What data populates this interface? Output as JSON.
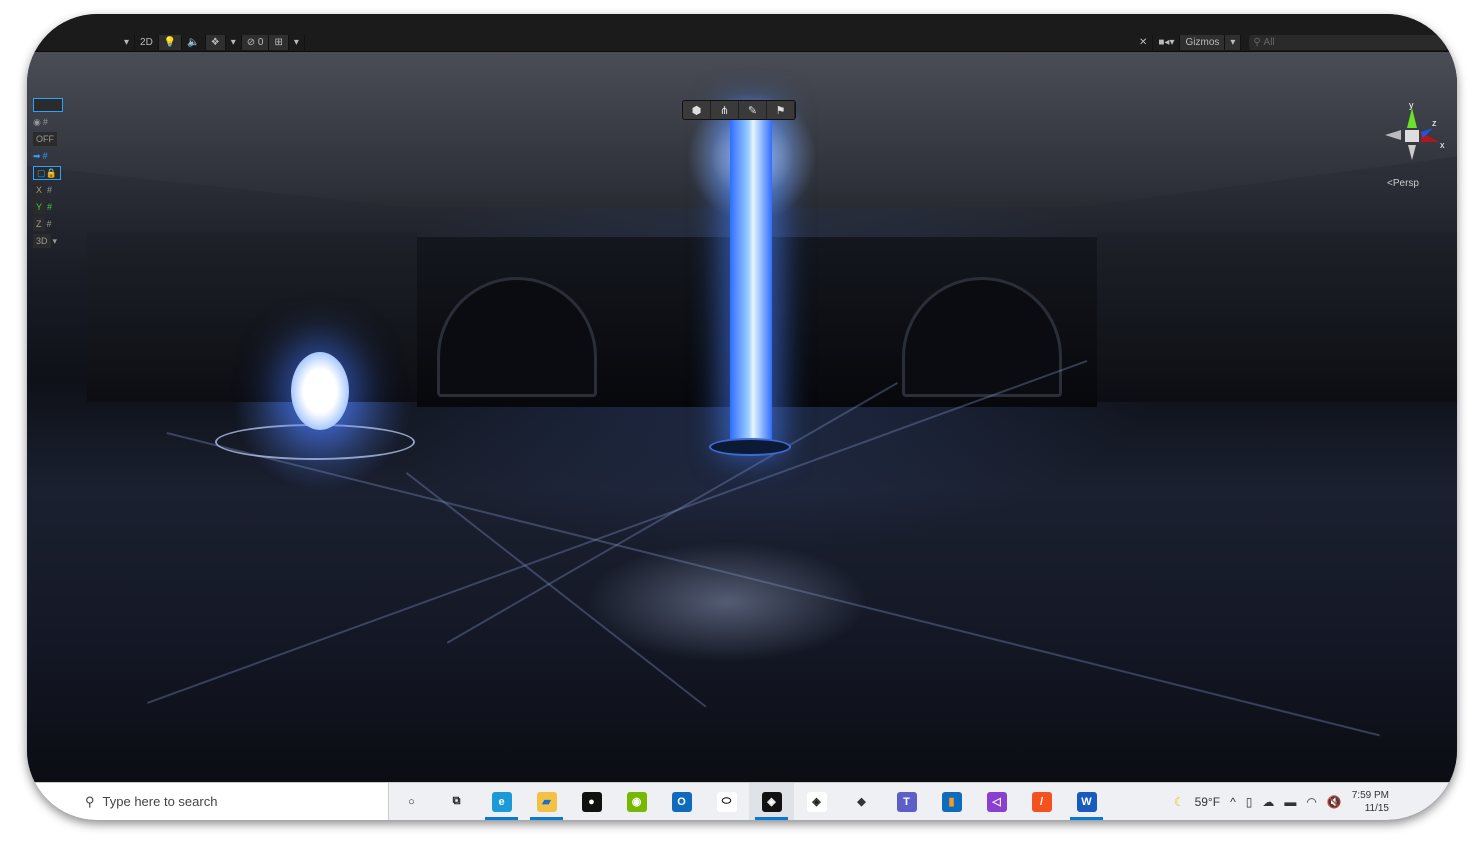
{
  "toolbar": {
    "view_mode": "2D",
    "hidden_count": "0",
    "gizmos_label": "Gizmos",
    "search_placeholder": "All"
  },
  "overlay_tools": [
    "cube-icon",
    "nodes-icon",
    "pen-icon",
    "flag-icon"
  ],
  "left_tools": {
    "off_label": "OFF",
    "x": "X",
    "y": "Y",
    "z": "Z",
    "three_d": "3D"
  },
  "gizmo": {
    "y": "y",
    "z": "z",
    "x": "x",
    "projection": "Persp"
  },
  "taskbar": {
    "search_placeholder": "Type here to search",
    "apps": [
      {
        "name": "cortana",
        "glyph": "○",
        "bg": "transparent",
        "color": "#222"
      },
      {
        "name": "task-view",
        "glyph": "⧉",
        "bg": "transparent",
        "color": "#222"
      },
      {
        "name": "edge",
        "glyph": "e",
        "bg": "#1a9ad6",
        "color": "#fff",
        "active": true
      },
      {
        "name": "file-explorer",
        "glyph": "▰",
        "bg": "#f3c143",
        "color": "#1a6fd0",
        "active": true
      },
      {
        "name": "app-black",
        "glyph": "●",
        "bg": "#111",
        "color": "#fff"
      },
      {
        "name": "nvidia",
        "glyph": "◉",
        "bg": "#76b900",
        "color": "#fff"
      },
      {
        "name": "outlook",
        "glyph": "O",
        "bg": "#0f6cbd",
        "color": "#fff"
      },
      {
        "name": "oculus",
        "glyph": "⬭",
        "bg": "#fff",
        "color": "#000"
      },
      {
        "name": "unity",
        "glyph": "◈",
        "bg": "#111",
        "color": "#fff",
        "active": true,
        "selected": true
      },
      {
        "name": "unity-hub",
        "glyph": "◈",
        "bg": "#fff",
        "color": "#222"
      },
      {
        "name": "alienware",
        "glyph": "◆",
        "bg": "transparent",
        "color": "#333"
      },
      {
        "name": "teams",
        "glyph": "T",
        "bg": "#5b5fc7",
        "color": "#fff"
      },
      {
        "name": "app-orange",
        "glyph": "▮",
        "bg": "#0f6cbd",
        "color": "#f59a23"
      },
      {
        "name": "visual-studio",
        "glyph": "◁",
        "bg": "#8a3fd1",
        "color": "#fff"
      },
      {
        "name": "app-pen",
        "glyph": "/",
        "bg": "#f4511e",
        "color": "#fff"
      },
      {
        "name": "word",
        "glyph": "W",
        "bg": "#185abd",
        "color": "#fff",
        "active": true
      }
    ],
    "weather": "59°F",
    "time": "7:59 PM",
    "date": "11/15"
  }
}
